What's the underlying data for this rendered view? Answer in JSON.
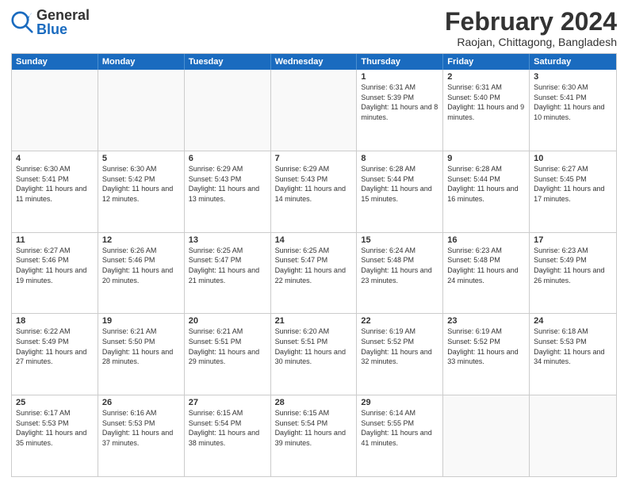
{
  "header": {
    "logo": {
      "general": "General",
      "blue": "Blue"
    },
    "title": "February 2024",
    "location": "Raojan, Chittagong, Bangladesh"
  },
  "weekdays": [
    "Sunday",
    "Monday",
    "Tuesday",
    "Wednesday",
    "Thursday",
    "Friday",
    "Saturday"
  ],
  "rows": [
    [
      {
        "day": "",
        "empty": true
      },
      {
        "day": "",
        "empty": true
      },
      {
        "day": "",
        "empty": true
      },
      {
        "day": "",
        "empty": true
      },
      {
        "day": "1",
        "sunrise": "6:31 AM",
        "sunset": "5:39 PM",
        "daylight": "11 hours and 8 minutes."
      },
      {
        "day": "2",
        "sunrise": "6:31 AM",
        "sunset": "5:40 PM",
        "daylight": "11 hours and 9 minutes."
      },
      {
        "day": "3",
        "sunrise": "6:30 AM",
        "sunset": "5:41 PM",
        "daylight": "11 hours and 10 minutes."
      }
    ],
    [
      {
        "day": "4",
        "sunrise": "6:30 AM",
        "sunset": "5:41 PM",
        "daylight": "11 hours and 11 minutes."
      },
      {
        "day": "5",
        "sunrise": "6:30 AM",
        "sunset": "5:42 PM",
        "daylight": "11 hours and 12 minutes."
      },
      {
        "day": "6",
        "sunrise": "6:29 AM",
        "sunset": "5:43 PM",
        "daylight": "11 hours and 13 minutes."
      },
      {
        "day": "7",
        "sunrise": "6:29 AM",
        "sunset": "5:43 PM",
        "daylight": "11 hours and 14 minutes."
      },
      {
        "day": "8",
        "sunrise": "6:28 AM",
        "sunset": "5:44 PM",
        "daylight": "11 hours and 15 minutes."
      },
      {
        "day": "9",
        "sunrise": "6:28 AM",
        "sunset": "5:44 PM",
        "daylight": "11 hours and 16 minutes."
      },
      {
        "day": "10",
        "sunrise": "6:27 AM",
        "sunset": "5:45 PM",
        "daylight": "11 hours and 17 minutes."
      }
    ],
    [
      {
        "day": "11",
        "sunrise": "6:27 AM",
        "sunset": "5:46 PM",
        "daylight": "11 hours and 19 minutes."
      },
      {
        "day": "12",
        "sunrise": "6:26 AM",
        "sunset": "5:46 PM",
        "daylight": "11 hours and 20 minutes."
      },
      {
        "day": "13",
        "sunrise": "6:25 AM",
        "sunset": "5:47 PM",
        "daylight": "11 hours and 21 minutes."
      },
      {
        "day": "14",
        "sunrise": "6:25 AM",
        "sunset": "5:47 PM",
        "daylight": "11 hours and 22 minutes."
      },
      {
        "day": "15",
        "sunrise": "6:24 AM",
        "sunset": "5:48 PM",
        "daylight": "11 hours and 23 minutes."
      },
      {
        "day": "16",
        "sunrise": "6:23 AM",
        "sunset": "5:48 PM",
        "daylight": "11 hours and 24 minutes."
      },
      {
        "day": "17",
        "sunrise": "6:23 AM",
        "sunset": "5:49 PM",
        "daylight": "11 hours and 26 minutes."
      }
    ],
    [
      {
        "day": "18",
        "sunrise": "6:22 AM",
        "sunset": "5:49 PM",
        "daylight": "11 hours and 27 minutes."
      },
      {
        "day": "19",
        "sunrise": "6:21 AM",
        "sunset": "5:50 PM",
        "daylight": "11 hours and 28 minutes."
      },
      {
        "day": "20",
        "sunrise": "6:21 AM",
        "sunset": "5:51 PM",
        "daylight": "11 hours and 29 minutes."
      },
      {
        "day": "21",
        "sunrise": "6:20 AM",
        "sunset": "5:51 PM",
        "daylight": "11 hours and 30 minutes."
      },
      {
        "day": "22",
        "sunrise": "6:19 AM",
        "sunset": "5:52 PM",
        "daylight": "11 hours and 32 minutes."
      },
      {
        "day": "23",
        "sunrise": "6:19 AM",
        "sunset": "5:52 PM",
        "daylight": "11 hours and 33 minutes."
      },
      {
        "day": "24",
        "sunrise": "6:18 AM",
        "sunset": "5:53 PM",
        "daylight": "11 hours and 34 minutes."
      }
    ],
    [
      {
        "day": "25",
        "sunrise": "6:17 AM",
        "sunset": "5:53 PM",
        "daylight": "11 hours and 35 minutes."
      },
      {
        "day": "26",
        "sunrise": "6:16 AM",
        "sunset": "5:53 PM",
        "daylight": "11 hours and 37 minutes."
      },
      {
        "day": "27",
        "sunrise": "6:15 AM",
        "sunset": "5:54 PM",
        "daylight": "11 hours and 38 minutes."
      },
      {
        "day": "28",
        "sunrise": "6:15 AM",
        "sunset": "5:54 PM",
        "daylight": "11 hours and 39 minutes."
      },
      {
        "day": "29",
        "sunrise": "6:14 AM",
        "sunset": "5:55 PM",
        "daylight": "11 hours and 41 minutes."
      },
      {
        "day": "",
        "empty": true
      },
      {
        "day": "",
        "empty": true
      }
    ]
  ]
}
